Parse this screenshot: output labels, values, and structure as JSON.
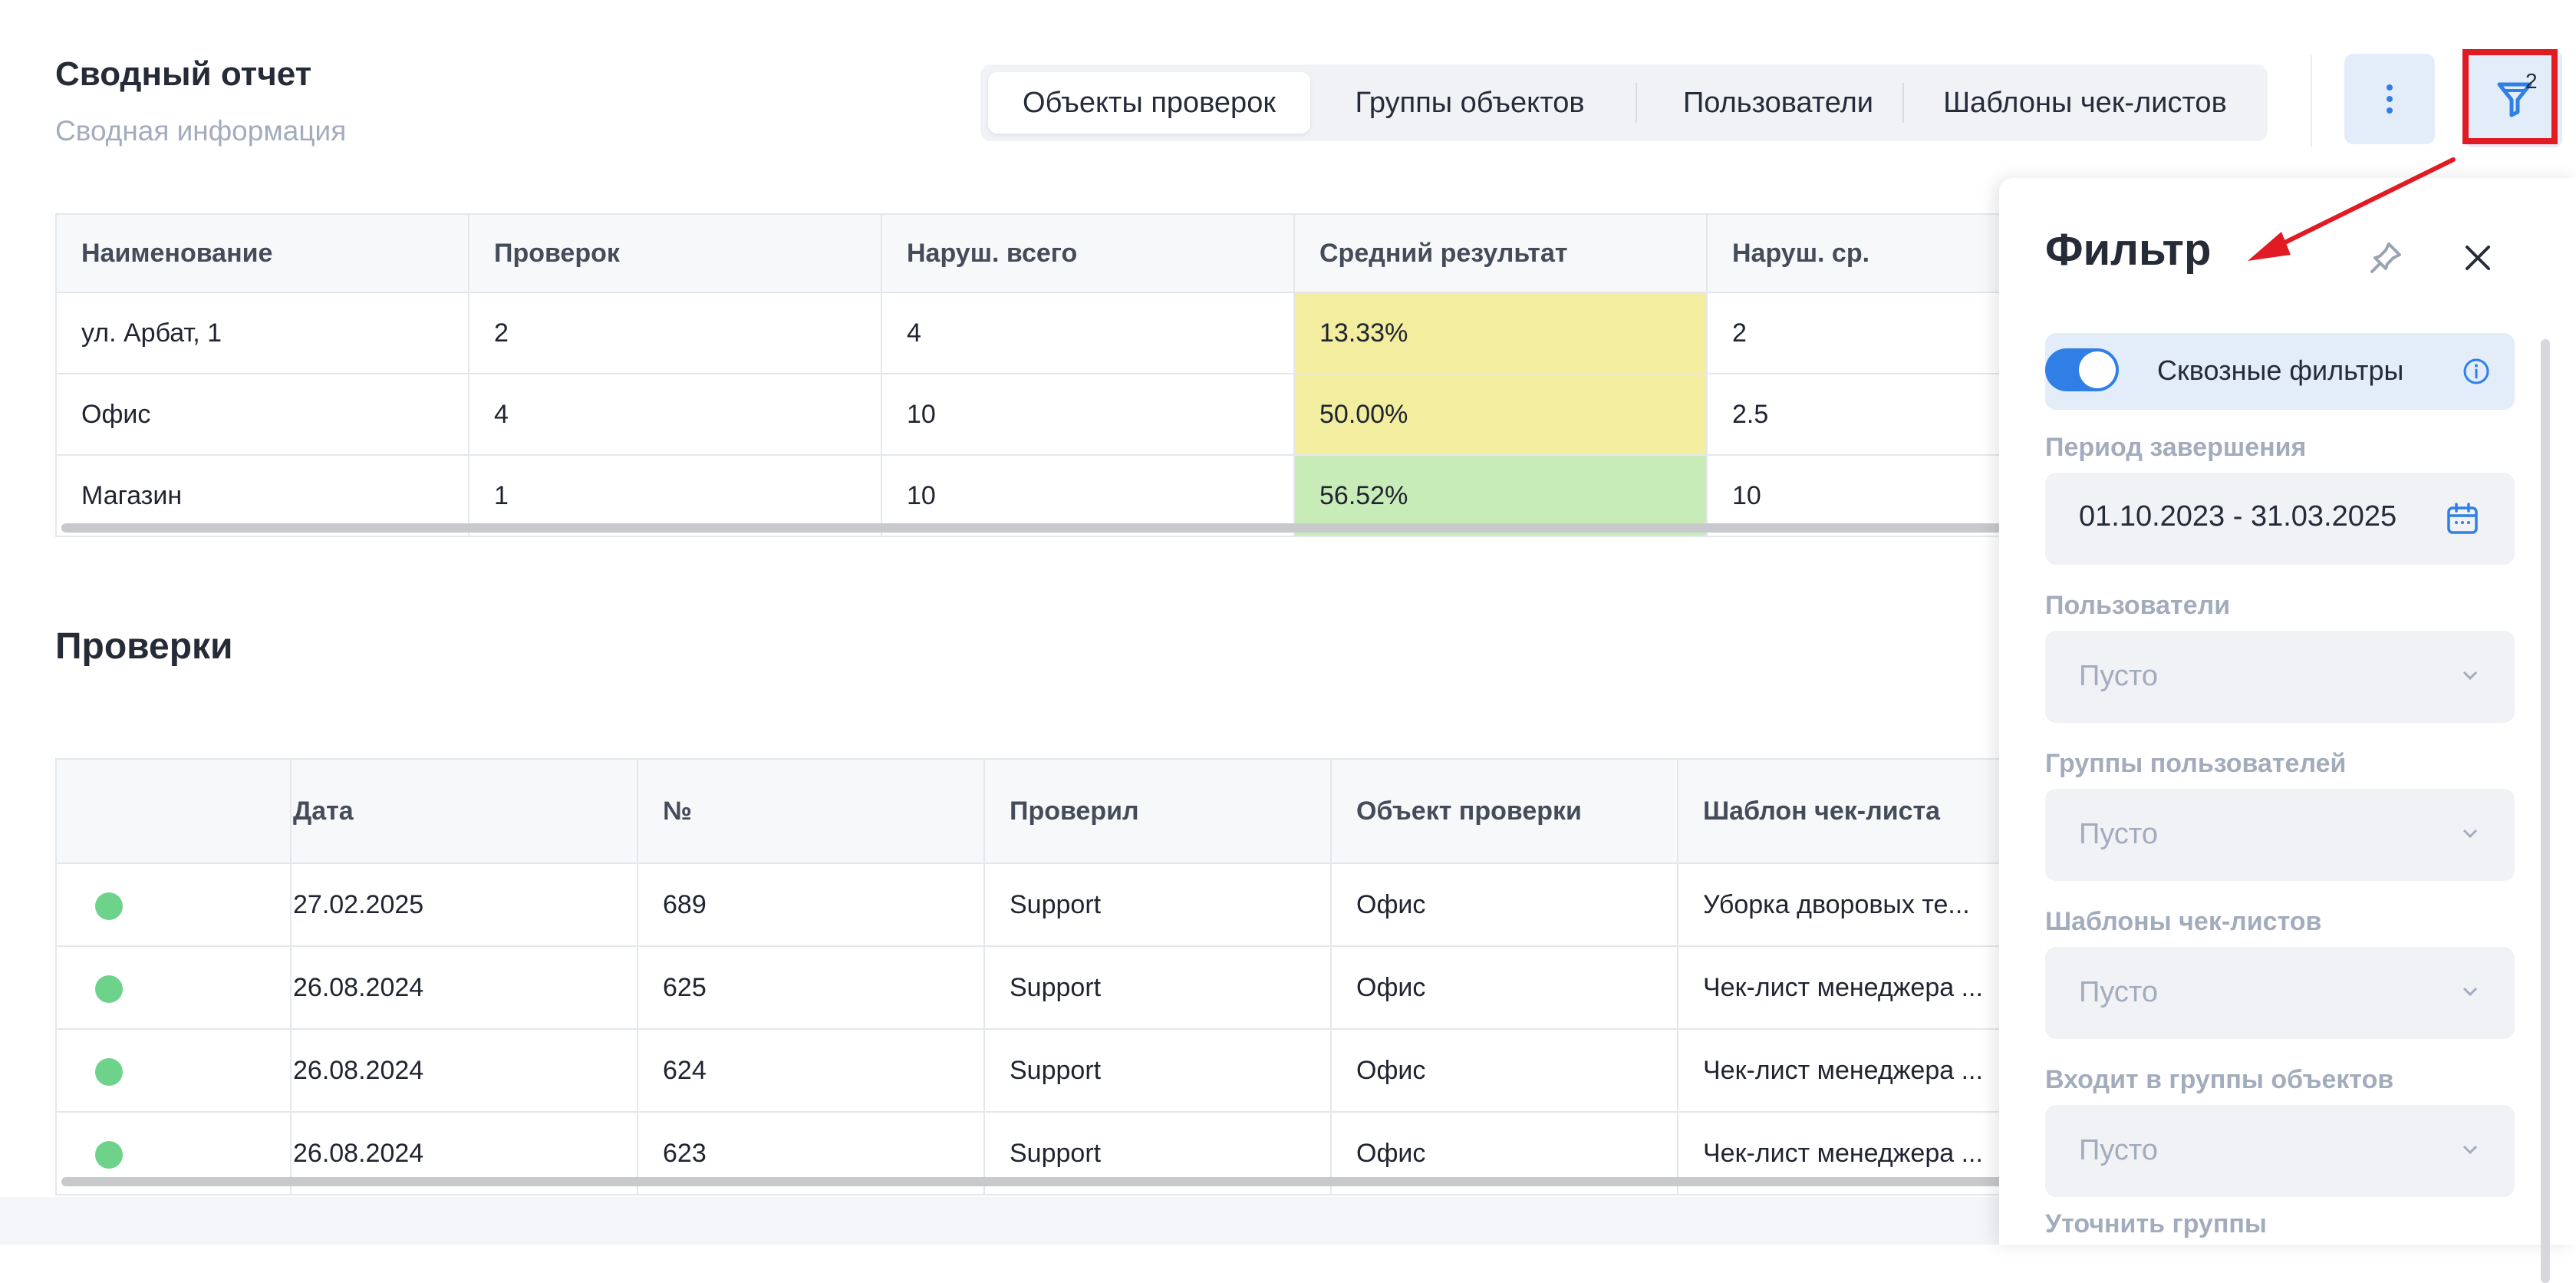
{
  "header": {
    "title": "Сводный отчет",
    "subtitle": "Сводная информация",
    "tabs": [
      "Объекты проверок",
      "Группы объектов",
      "Пользователи",
      "Шаблоны чек-листов"
    ],
    "active_tab": "Объекты проверок",
    "more_icon": "vertical-dots-icon",
    "filter_icon": "funnel-icon",
    "filter_badge": "2"
  },
  "summary_table": {
    "columns": [
      "Наименование",
      "Проверок",
      "Наруш. всего",
      "Средний результат",
      "Наруш. ср."
    ],
    "rows": [
      [
        "ул. Арбат, 1",
        "2",
        "4",
        "13.33%",
        "2"
      ],
      [
        "Офис",
        "4",
        "10",
        "50.00%",
        "2.5"
      ],
      [
        "Магазин",
        "1",
        "10",
        "56.52%",
        "10"
      ]
    ],
    "result_colors": [
      "#f2ed9f",
      "#f2ed9f",
      "#c8ecb8"
    ]
  },
  "checks": {
    "title": "Проверки",
    "columns": [
      "",
      "Дата",
      "№",
      "Проверил",
      "Объект проверки",
      "Шаблон чек-листа"
    ],
    "rows": [
      [
        "27.02.2025",
        "689",
        "Support",
        "Офис",
        "Уборка дворовых те..."
      ],
      [
        "26.08.2024",
        "625",
        "Support",
        "Офис",
        "Чек-лист менеджера ..."
      ],
      [
        "26.08.2024",
        "624",
        "Support",
        "Офис",
        "Чек-лист менеджера ..."
      ],
      [
        "26.08.2024",
        "623",
        "Support",
        "Офис",
        "Чек-лист менеджера ..."
      ]
    ],
    "status_color": "#6ed38a"
  },
  "filter_panel": {
    "title": "Фильтр",
    "pin_icon": "pin-icon",
    "close_icon": "close-icon",
    "through_filters_label": "Сквозные фильтры",
    "through_filters_on": true,
    "info_icon": "info-icon",
    "period_label": "Период завершения",
    "period_value": "01.10.2023 - 31.03.2025",
    "calendar_icon": "calendar-icon",
    "users_label": "Пользователи",
    "users_placeholder": "Пусто",
    "user_groups_label": "Группы пользователей",
    "user_groups_placeholder": "Пусто",
    "templates_label": "Шаблоны чек-листов",
    "templates_placeholder": "Пусто",
    "object_groups_label": "Входит в группы объектов",
    "object_groups_placeholder": "Пусто",
    "refine_groups_label": "Уточнить группы"
  },
  "colors": {
    "accent": "#2f7fe6",
    "highlight": "#e01b24"
  }
}
